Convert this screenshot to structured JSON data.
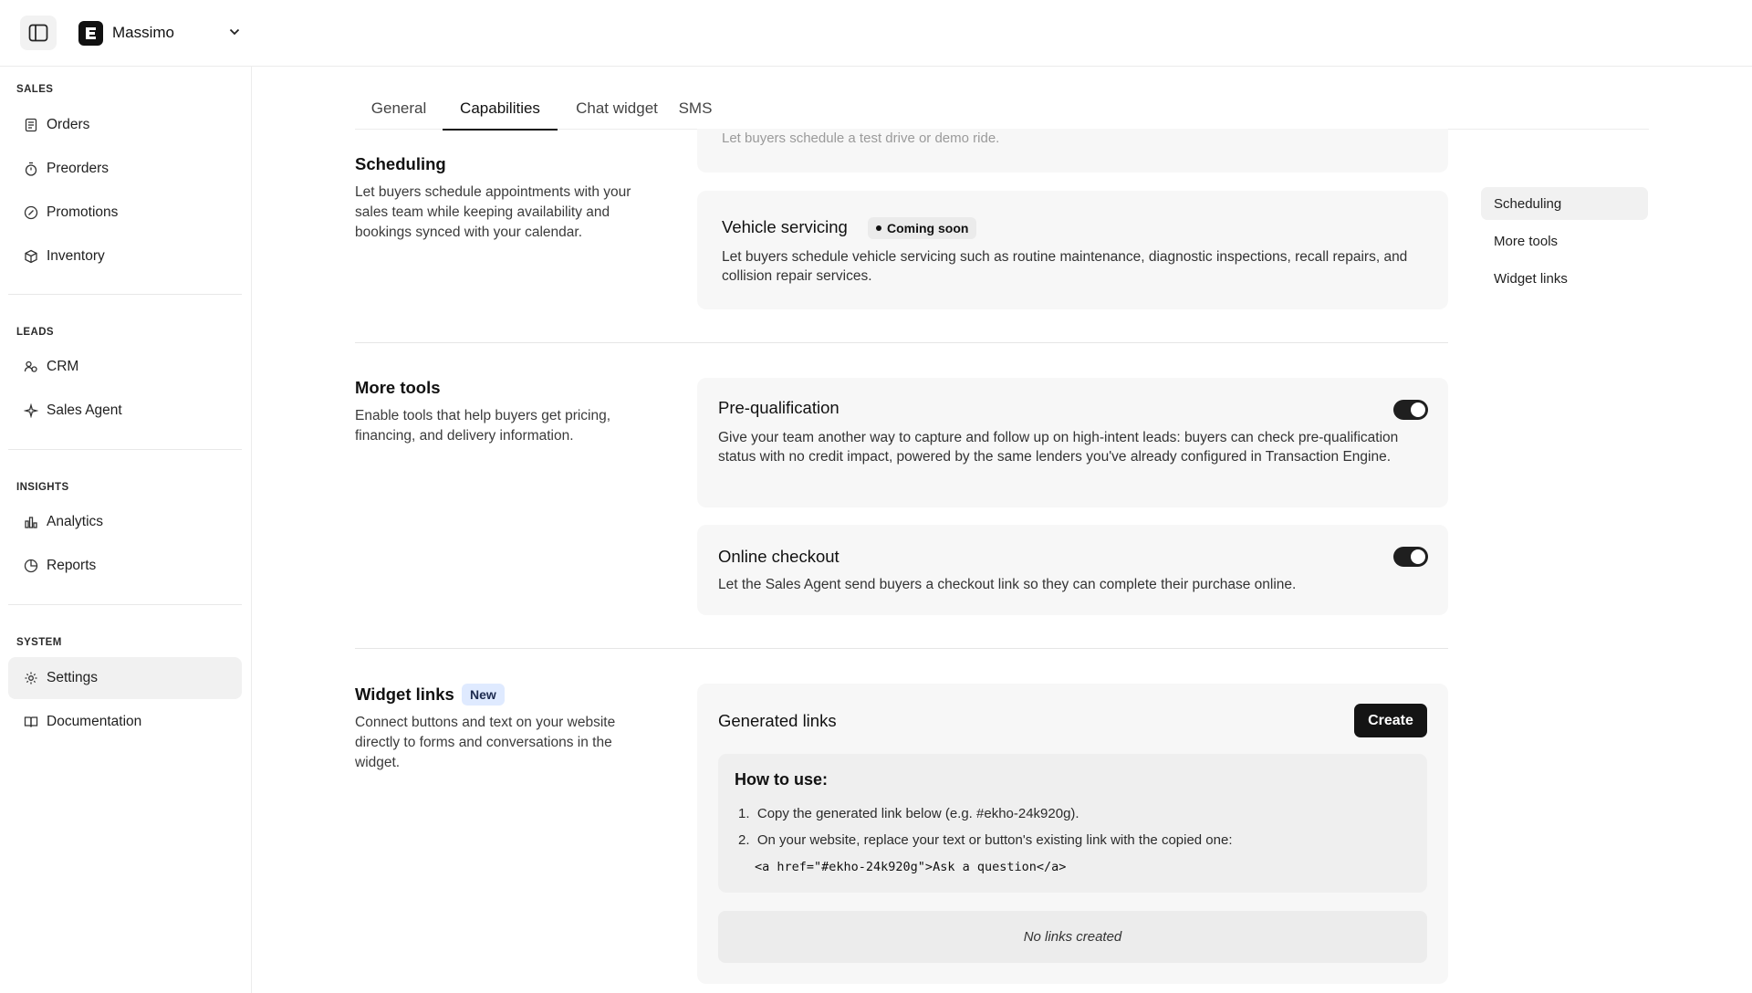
{
  "brand": {
    "name": "Massimo",
    "logo_letter": "E"
  },
  "sidebar": {
    "sections": [
      {
        "title": "SALES",
        "items": [
          "Orders",
          "Preorders",
          "Promotions",
          "Inventory"
        ]
      },
      {
        "title": "LEADS",
        "items": [
          "CRM",
          "Sales Agent"
        ]
      },
      {
        "title": "INSIGHTS",
        "items": [
          "Analytics",
          "Reports"
        ]
      },
      {
        "title": "SYSTEM",
        "items": [
          "Settings",
          "Documentation"
        ]
      }
    ],
    "active_item": "Settings"
  },
  "tabs": {
    "items": [
      "General",
      "Capabilities",
      "Chat widget",
      "SMS"
    ],
    "active": "Capabilities"
  },
  "scheduling": {
    "title": "Scheduling",
    "description": "Let buyers schedule appointments with your sales team while keeping availability and bookings synced with your calendar.",
    "faded_card_desc": "Let buyers schedule a test drive or demo ride.",
    "vehicle_servicing": {
      "title": "Vehicle servicing",
      "badge": "Coming soon",
      "description": "Let buyers schedule vehicle servicing such as routine maintenance, diagnostic inspections, recall repairs, and collision repair services."
    }
  },
  "more_tools": {
    "title": "More tools",
    "description": "Enable tools that help buyers get pricing, financing, and delivery information.",
    "prequal": {
      "title": "Pre-qualification",
      "description": "Give your team another way to capture and follow up on high-intent leads: buyers can check pre-qualification status with no credit impact, powered by the same lenders you've already configured in Transaction Engine.",
      "enabled": true
    },
    "checkout": {
      "title": "Online checkout",
      "description": "Let the Sales Agent send buyers a checkout link so they can complete their purchase online.",
      "enabled": true
    }
  },
  "widget_links": {
    "title": "Widget links",
    "badge": "New",
    "description": "Connect buttons and text on your website directly to forms and conversations in the widget.",
    "generated_title": "Generated links",
    "create_label": "Create",
    "howto_title": "How to use:",
    "steps": [
      "Copy the generated link below (e.g. #ekho-24k920g).",
      "On your website, replace your text or button's existing link with the copied one:"
    ],
    "code_example": "<a href=\"#ekho-24k920g\">Ask a question</a>",
    "empty_text": "No links created"
  },
  "anchors": {
    "items": [
      "Scheduling",
      "More tools",
      "Widget links"
    ],
    "active": "Scheduling"
  },
  "colors": {
    "accent": "#111111",
    "card_bg": "#f7f7f7",
    "new_badge_bg": "#dfeaff"
  }
}
